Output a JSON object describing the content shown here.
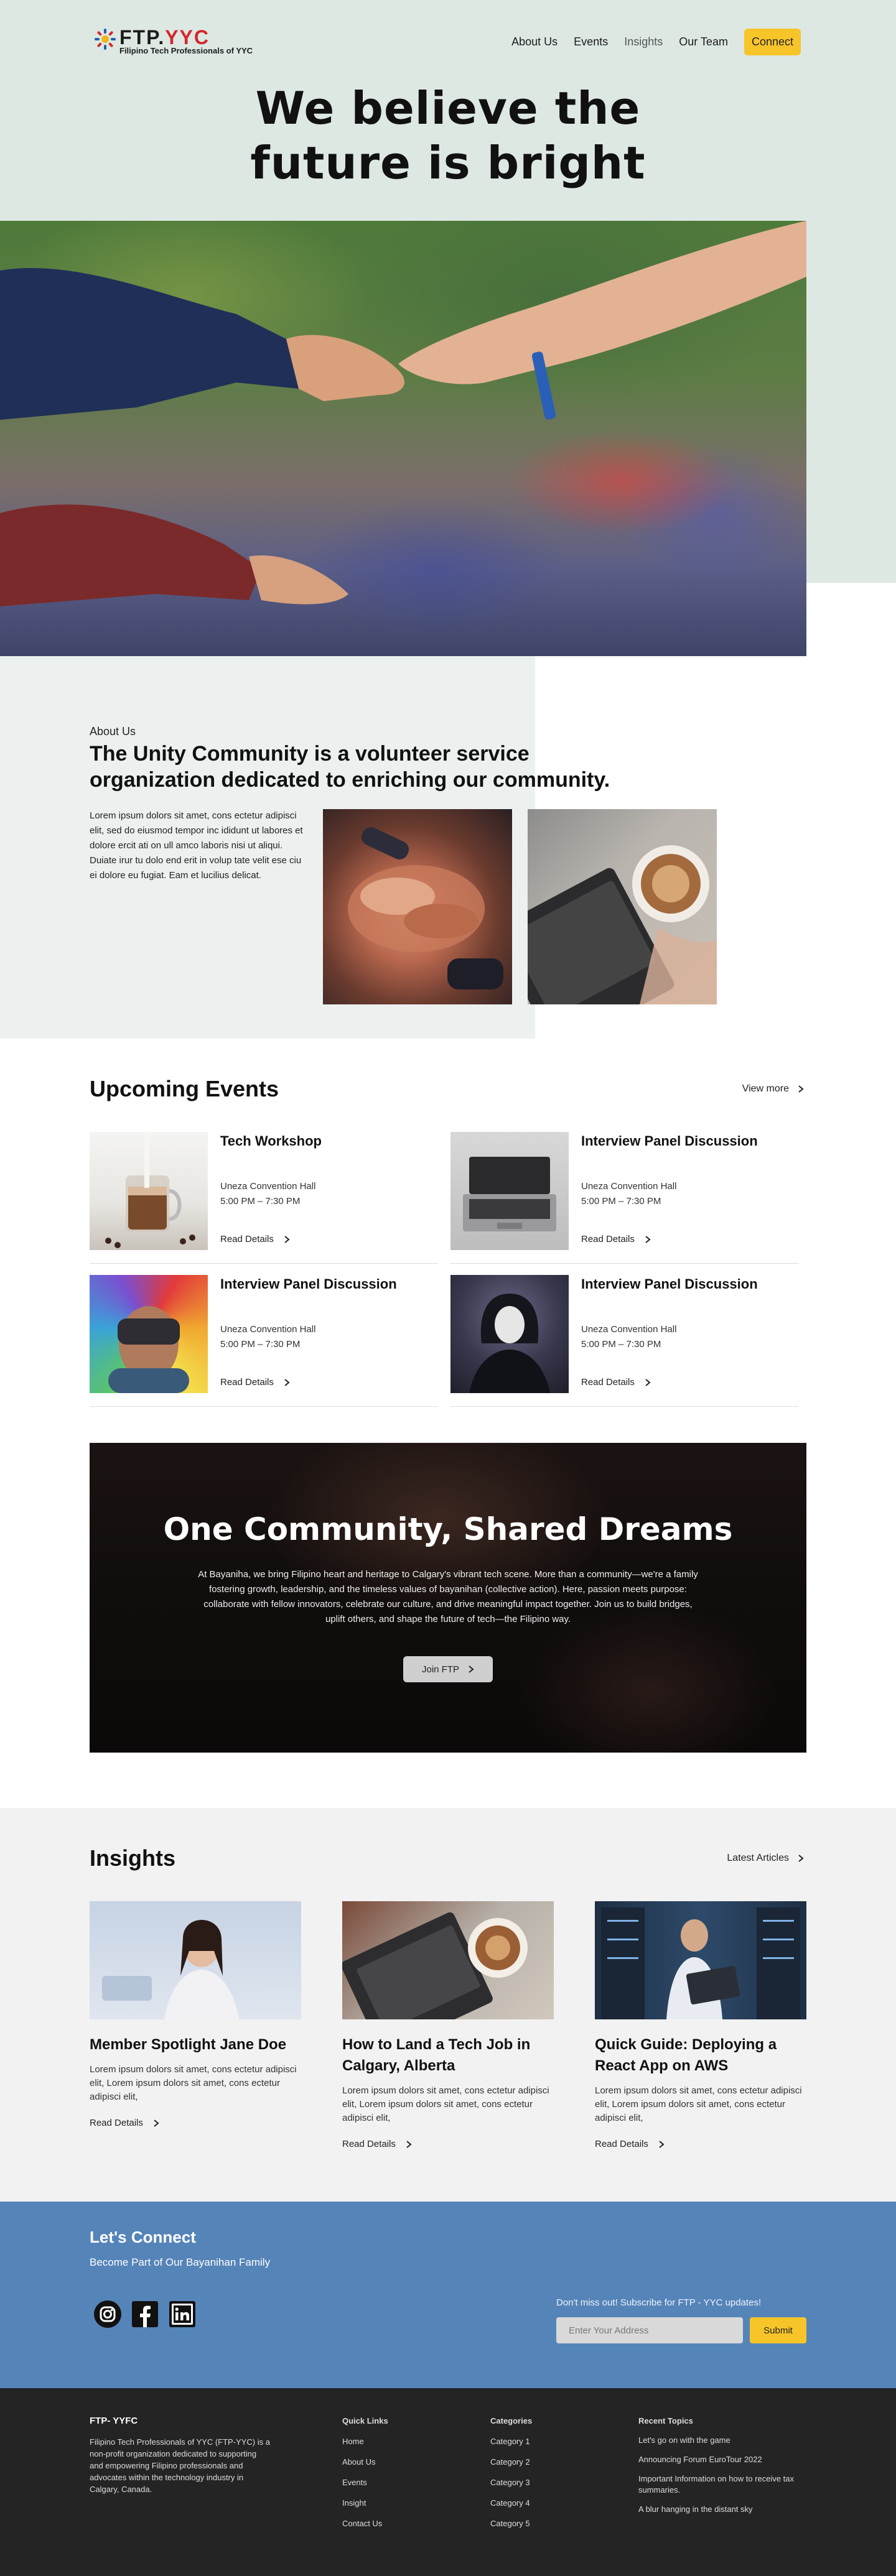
{
  "nav": {
    "logo_text_1": "FTP.",
    "logo_text_2": "YYC",
    "logo_subtitle": "Filipino Tech Professionals of YYC",
    "links": [
      "About Us",
      "Events",
      "Insights",
      "Our Team"
    ],
    "connect_label": "Connect"
  },
  "hero": {
    "title_line1": "We  believe the",
    "title_line2": "future is bright"
  },
  "about": {
    "eyebrow": "About Us",
    "title": "The Unity Community is a volunteer service organization dedicated to enriching our community.",
    "text": "Lorem ipsum dolors sit amet, cons ectetur adipisci elit, sed do eiusmod tempor inc ididunt ut labores et dolore ercit ati on ull amco laboris nisi ut aliqui. Duiate irur tu dolo end erit in volup tate velit ese ciu ei dolore eu fugiat. Eam et lucilius delicat."
  },
  "events": {
    "title": "Upcoming Events",
    "view_more": "View more",
    "items": [
      {
        "title": "Tech Workshop",
        "venue": "Uneza Convention Hall",
        "time": "5:00 PM – 7:30 PM",
        "read": "Read Details"
      },
      {
        "title": "Interview Panel Discussion",
        "venue": "Uneza Convention Hall",
        "time": "5:00 PM – 7:30 PM",
        "read": "Read Details"
      },
      {
        "title": "Interview Panel Discussion",
        "venue": "Uneza Convention Hall",
        "time": "5:00 PM – 7:30 PM",
        "read": "Read Details"
      },
      {
        "title": "Interview Panel Discussion",
        "venue": "Uneza Convention Hall",
        "time": "5:00 PM – 7:30 PM",
        "read": "Read Details"
      }
    ]
  },
  "banner": {
    "title": "One Community, Shared Dreams",
    "text": "At Bayaniha, we bring Filipino heart and heritage to Calgary's vibrant tech scene. More than a community—we're a family fostering growth, leadership, and the timeless values of bayanihan (collective action). Here, passion meets purpose: collaborate with fellow innovators, celebrate our culture, and drive meaningful impact together. Join us to build bridges, uplift others, and shape the future of tech—the Filipino way.",
    "button": "Join FTP"
  },
  "insights": {
    "title": "Insights",
    "latest": "Latest Articles",
    "posts": [
      {
        "title": "Member Spotlight Jane Doe",
        "text": "Lorem ipsum dolors sit amet, cons ectetur adipisci elit, Lorem ipsum dolors sit amet, cons ectetur adipisci elit,",
        "read": "Read Details"
      },
      {
        "title": "How to Land a Tech Job in Calgary, Alberta",
        "text": "Lorem ipsum dolors sit amet, cons ectetur adipisci elit, Lorem ipsum dolors sit amet, cons ectetur adipisci elit,",
        "read": "Read Details"
      },
      {
        "title": "Quick Guide: Deploying a React App on AWS",
        "text": "Lorem ipsum dolors sit amet, cons ectetur adipisci elit, Lorem ipsum dolors sit amet, cons ectetur adipisci elit,",
        "read": "Read Details"
      }
    ]
  },
  "connect": {
    "title": "Let's Connect",
    "subtitle": "Become Part of Our Bayanihan Family",
    "social_icons": [
      "instagram-icon",
      "facebook-icon",
      "linkedin-icon"
    ],
    "subscribe_label": "Don't miss out! Subscribe for FTP - YYC updates!",
    "input_placeholder": "Enter Your Address",
    "submit": "Submit"
  },
  "footer": {
    "about_title": "FTP- YYFC",
    "about_text": "Filipino Tech Professionals of YYC (FTP-YYC) is a non-profit organization dedicated to supporting and empowering Filipino professionals and advocates within the technology industry in Calgary, Canada.",
    "quick_links_title": "Quick Links",
    "quick_links": [
      "Home",
      "About Us",
      "Events",
      "Insight",
      "Contact Us"
    ],
    "categories_title": "Categories",
    "categories": [
      "Category 1",
      "Category 2",
      "Category 3",
      "Category 4",
      "Category 5"
    ],
    "topics_title": "Recent Topics",
    "topics": [
      "Let's go on with the game",
      "Announcing Forum EuroTour 2022",
      "Important Information on how to receive tax summaries.",
      "A blur hanging in the distant sky"
    ]
  },
  "colors": {
    "hero_bg": "#dde8e3",
    "about_bg": "#ecf1ef",
    "accent_yellow": "#f7c52a",
    "connect_blue": "#5584b9",
    "footer_bg": "#242424",
    "logo_red": "#d4262b"
  }
}
